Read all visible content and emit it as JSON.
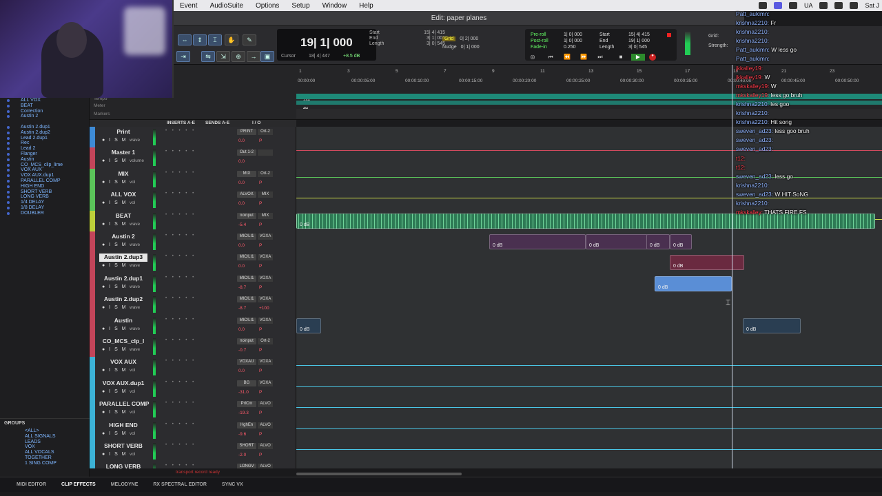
{
  "menu": [
    "Event",
    "AudioSuite",
    "Options",
    "Setup",
    "Window",
    "Help"
  ],
  "menu_right": {
    "app_label": "UA",
    "clock": "Sat J"
  },
  "edit_window_title": "Edit: paper planes",
  "counter": {
    "main": "19| 1| 000",
    "cursor_label": "Cursor",
    "cursor_value": "18| 4| 447",
    "level": "+8.5 dB"
  },
  "selection": [
    {
      "label": "Start",
      "value": "15| 4| 415"
    },
    {
      "label": "End",
      "value": "3| 1| 000"
    },
    {
      "label": "Length",
      "value": "3| 0| 545"
    }
  ],
  "grid": {
    "grid_label": "Grid",
    "grid_value": "0| 2| 000",
    "nudge_label": "Nudge",
    "nudge_value": "0| 1| 000"
  },
  "transport": {
    "preroll": "Pre-roll",
    "preroll_v": "1| 0| 000",
    "postroll": "Post-roll",
    "postroll_v": "1| 0| 000",
    "fadein": "Fade-in",
    "fadein_v": "0.250",
    "start": "Start",
    "start_v": "15| 4| 415",
    "end": "End",
    "end_v": "19| 1| 000",
    "length": "Length",
    "length_v": "3| 0| 545"
  },
  "grid_strength": {
    "grid": "Grid:",
    "strength": "Strength:"
  },
  "chat": [
    {
      "user": "Patt_aukimn:",
      "text": "",
      "red": false
    },
    {
      "user": "krishna2210:",
      "text": "Fr",
      "red": false
    },
    {
      "user": "krishna2210:",
      "text": "",
      "red": false
    },
    {
      "user": "krishna2210:",
      "text": "",
      "red": false
    },
    {
      "user": "Patt_aukimn:",
      "text": "W less go",
      "red": false
    },
    {
      "user": "Patt_aukimn:",
      "text": "",
      "red": false
    },
    {
      "user": "jkkalley19:",
      "text": "",
      "red": true
    },
    {
      "user": "jkkalley19:",
      "text": "W",
      "red": true
    },
    {
      "user": "mkskalley19:",
      "text": "W",
      "red": true
    },
    {
      "user": "mkskalley19:",
      "text": "less go bruh",
      "red": true
    },
    {
      "user": "krishna2210:",
      "text": "les goo",
      "red": false
    },
    {
      "user": "krishna2210:",
      "text": "",
      "red": false
    },
    {
      "user": "krishna2210:",
      "text": "Hit song",
      "red": false
    },
    {
      "user": "sweven_ad23:",
      "text": "less goo bruh",
      "red": false
    },
    {
      "user": "sweven_ad23:",
      "text": "",
      "red": false
    },
    {
      "user": "sweven_ad23:",
      "text": "",
      "red": false
    },
    {
      "user": "t12:",
      "text": "",
      "red": true
    },
    {
      "user": "t12:",
      "text": "",
      "red": true
    },
    {
      "user": "sweven_ad23:",
      "text": "less go",
      "red": false
    },
    {
      "user": "krishna2210:",
      "text": "",
      "red": false
    },
    {
      "user": "sweven_ad23:",
      "text": "W HIT SoNG",
      "red": false
    },
    {
      "user": "krishna2210:",
      "text": "",
      "red": false
    },
    {
      "user": "mkskalley:",
      "text": "THATS FIRE FS",
      "red": true
    }
  ],
  "clip_list": [
    "ALL VOX",
    "BEAT",
    "Correction",
    "Austin 2",
    "Austin 2.dup3",
    "Austin 2.dup1",
    "Austin 2.dup2",
    "Lead 2.dup1",
    "Rec",
    "Lead 2",
    "Flanger",
    "Austin",
    "CO_MCS_clip_lime",
    "VOX AUX",
    "VOX AUX.dup1",
    "PARALLEL COMP",
    "HIGH END",
    "SHORT VERB",
    "LONG VERB",
    "1/4 DELAY",
    "1/8 DELAY",
    "DOUBLER"
  ],
  "groups": {
    "header": "GROUPS",
    "items": [
      "<ALL>",
      "ALL SIGNALS",
      "LEADS",
      "VOX",
      "ALL VOCALS",
      "TOGETHER",
      "1 SING COMP"
    ]
  },
  "ruler": {
    "labels": [
      "Tempo",
      "Meter",
      "Markers"
    ],
    "bars": [
      "1",
      "3",
      "5",
      "7",
      "9",
      "11",
      "13",
      "15",
      "17",
      "19",
      "21",
      "23"
    ],
    "mins": [
      "00:00:00",
      "00:00:05:00",
      "00:00:10:00",
      "00:00:15:00",
      "00:00:20:00",
      "00:00:25:00",
      "00:00:30:00",
      "00:00:35:00",
      "00:00:40:00",
      "00:00:45:00",
      "00:00:50:00"
    ],
    "tempo_value": "100",
    "meter_value": "4/4"
  },
  "mix_head": {
    "inserts": "INSERTS A-E",
    "sends": "SENDS A-E",
    "io": "I / O"
  },
  "tracks": [
    {
      "name": "Print",
      "color": "#3e8bd6",
      "io": "PRINT",
      "out": "Ort-2",
      "mode": "wave",
      "vol": "0.0",
      "pan": "P",
      "lane": "#2f3133"
    },
    {
      "name": "Master 1",
      "color": "#c3455a",
      "io": "Out 1-2",
      "out": "",
      "mode": "volume",
      "vol": "0.0",
      "pan": "",
      "lane": "#2f3133"
    },
    {
      "name": "MIX",
      "color": "#5bc45a",
      "io": "MIX",
      "out": "Ort-2",
      "mode": "vol",
      "vol": "0.0",
      "pan": "P",
      "lane": "#2f3133"
    },
    {
      "name": "ALL VOX",
      "color": "#5bc45a",
      "io": "ALVOX",
      "out": "MIX",
      "mode": "vol",
      "vol": "0.0",
      "pan": "P",
      "lane": "#2f3133"
    },
    {
      "name": "BEAT",
      "color": "#bccf3a",
      "io": "noinput",
      "out": "MIX",
      "mode": "wave",
      "vol": "-5.4",
      "pan": "P",
      "lane": "#2f3133"
    },
    {
      "name": "Austin 2",
      "color": "#c3455a",
      "io": "MIC/LI1",
      "out": "VOXA",
      "mode": "wave",
      "vol": "0.0",
      "pan": "P",
      "lane": "#2f3133"
    },
    {
      "name": "Austin 2.dup3",
      "color": "#c3455a",
      "io": "MIC/LI1",
      "out": "VOXA",
      "mode": "wave",
      "vol": "0.0",
      "pan": "P",
      "lane": "#2f3133"
    },
    {
      "name": "Austin 2.dup1",
      "color": "#c3455a",
      "io": "MIC/LI1",
      "out": "VOXA",
      "mode": "wave",
      "vol": "-8.7",
      "pan": "P",
      "lane": "#2f3133"
    },
    {
      "name": "Austin 2.dup2",
      "color": "#c3455a",
      "io": "MIC/LI1",
      "out": "VOXA",
      "mode": "wave",
      "vol": "-8.7",
      "pan": "+100",
      "lane": "#2f3133"
    },
    {
      "name": "Austin",
      "color": "#c3455a",
      "io": "MIC/LI1",
      "out": "VOXA",
      "mode": "wave",
      "vol": "0.0",
      "pan": "P",
      "lane": "#2f3133"
    },
    {
      "name": "CO_MCS_clp_l",
      "color": "#c3455a",
      "io": "noinput",
      "out": "Ort-2",
      "mode": "wave",
      "vol": "-0.7",
      "pan": "P",
      "lane": "#2f3133"
    },
    {
      "name": "VOX AUX",
      "color": "#3cb2d6",
      "io": "VOXAU",
      "out": "VOXA",
      "mode": "vol",
      "vol": "0.0",
      "pan": "P",
      "lane": "#2f3133"
    },
    {
      "name": "VOX AUX.dup1",
      "color": "#3cb2d6",
      "io": "BG",
      "out": "VOXA",
      "mode": "vol",
      "vol": "-31.0",
      "pan": "P",
      "lane": "#2f3133"
    },
    {
      "name": "PARALLEL COMP",
      "color": "#3cb2d6",
      "io": "PrlCm",
      "out": "ALVO",
      "mode": "vol",
      "vol": "-19.3",
      "pan": "P",
      "lane": "#2f3133"
    },
    {
      "name": "HIGH END",
      "color": "#3cb2d6",
      "io": "HghEn",
      "out": "ALVO",
      "mode": "vol",
      "vol": "-9.6",
      "pan": "P",
      "lane": "#2f3133"
    },
    {
      "name": "SHORT VERB",
      "color": "#3cb2d6",
      "io": "SHORT",
      "out": "ALVO",
      "mode": "vol",
      "vol": "-2.0",
      "pan": "P",
      "lane": "#2f3133"
    },
    {
      "name": "LONG VERB",
      "color": "#3cb2d6",
      "io": "LONGV",
      "out": "ALVO",
      "mode": "vol",
      "vol": "",
      "pan": "",
      "lane": "#2f3133"
    }
  ],
  "clips": [
    {
      "track": 4,
      "label": "0 dB",
      "color": "#2e7a55"
    },
    {
      "track": 5,
      "label": "0 dB",
      "color": "#4a3050"
    },
    {
      "track": 5,
      "label": "0 dB",
      "color": "#4a3050"
    },
    {
      "track": 5,
      "label": "0 dB",
      "color": "#4a3050"
    },
    {
      "track": 5,
      "label": "0 dB",
      "color": "#4a3050"
    },
    {
      "track": 6,
      "label": "0 dB",
      "color": "#6a2a40"
    },
    {
      "track": 7,
      "label": "0 dB",
      "color": "#5a8ed6"
    },
    {
      "track": 9,
      "label": "0 dB",
      "color": "#2a3e52"
    },
    {
      "track": 9,
      "label": "0 dB",
      "color": "#2a3e52"
    }
  ],
  "status_text": "transport record ready",
  "bottom_tabs": [
    "MIDI EDITOR",
    "CLIP EFFECTS",
    "MELODYNE",
    "RX SPECTRAL EDITOR",
    "SYNC VX"
  ]
}
